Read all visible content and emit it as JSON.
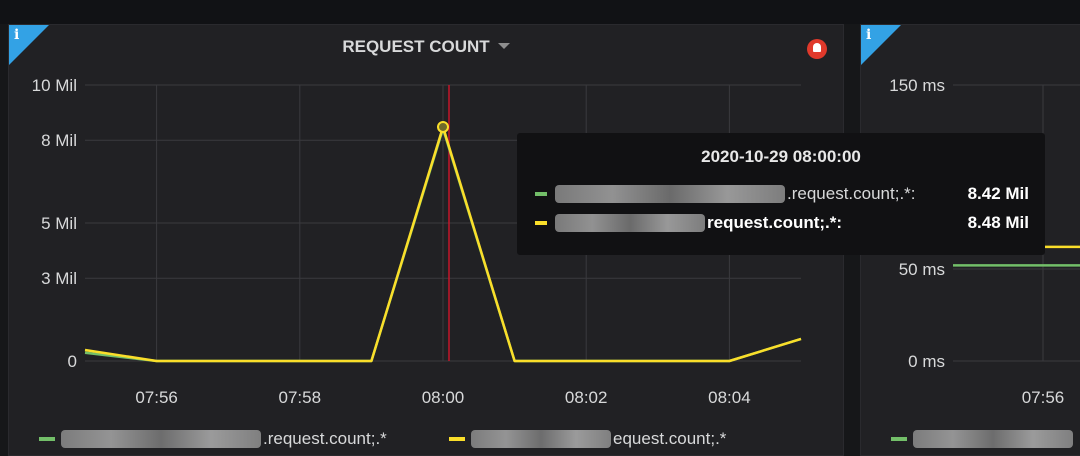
{
  "left_panel": {
    "title": "REQUEST COUNT",
    "icons": [
      "info-icon",
      "caret-down-icon",
      "alert-bell-icon"
    ],
    "legend": [
      {
        "label": ".request.count;.*",
        "color": "#73bf69"
      },
      {
        "label": "equest.count;.*",
        "color": "#fade2a"
      }
    ],
    "tooltip": {
      "time": "2020-10-29 08:00:00",
      "rows": [
        {
          "label": ".request.count;.*:",
          "value": "8.42 Mil",
          "color": "#73bf69"
        },
        {
          "label": "request.count;.*:",
          "value": "8.48 Mil",
          "color": "#fade2a"
        }
      ]
    }
  },
  "right_panel": {
    "icons": [
      "info-icon"
    ],
    "y_ticks": [
      "150 ms",
      "50 ms",
      "0 ms"
    ],
    "x_ticks": [
      "07:56"
    ]
  },
  "chart_data": [
    {
      "type": "line",
      "title": "REQUEST COUNT",
      "x": [
        "07:55",
        "07:56",
        "07:57",
        "07:58",
        "07:59",
        "08:00",
        "08:01",
        "08:02",
        "08:03",
        "08:04",
        "08:05"
      ],
      "x_tick_labels": [
        "07:56",
        "07:58",
        "08:00",
        "08:02",
        "08:04"
      ],
      "y_tick_labels": [
        "10 Mil",
        "8 Mil",
        "5 Mil",
        "3 Mil",
        "0"
      ],
      "y_ticks": [
        10000000,
        8000000,
        5000000,
        3000000,
        0
      ],
      "ylim": [
        0,
        10000000
      ],
      "series": [
        {
          "color": "#73bf69",
          "values": [
            300000,
            0,
            0,
            0,
            0,
            8420000,
            0,
            0,
            0,
            0,
            800000
          ]
        },
        {
          "color": "#fade2a",
          "values": [
            400000,
            0,
            0,
            0,
            0,
            8480000,
            0,
            0,
            0,
            0,
            800000
          ]
        }
      ],
      "grid": true,
      "legend": "bottom",
      "crosshair_x": "08:00"
    },
    {
      "type": "line",
      "y_tick_labels": [
        "150 ms",
        "50 ms",
        "0 ms"
      ],
      "y_ticks": [
        150,
        50,
        0
      ],
      "ylim": [
        0,
        150
      ],
      "x_tick_labels": [
        "07:56"
      ],
      "series": [
        {
          "color": "#73bf69",
          "values": [
            52,
            52
          ]
        },
        {
          "color": "#fade2a",
          "values": [
            62,
            62
          ]
        }
      ],
      "grid": true,
      "legend": "bottom"
    }
  ]
}
